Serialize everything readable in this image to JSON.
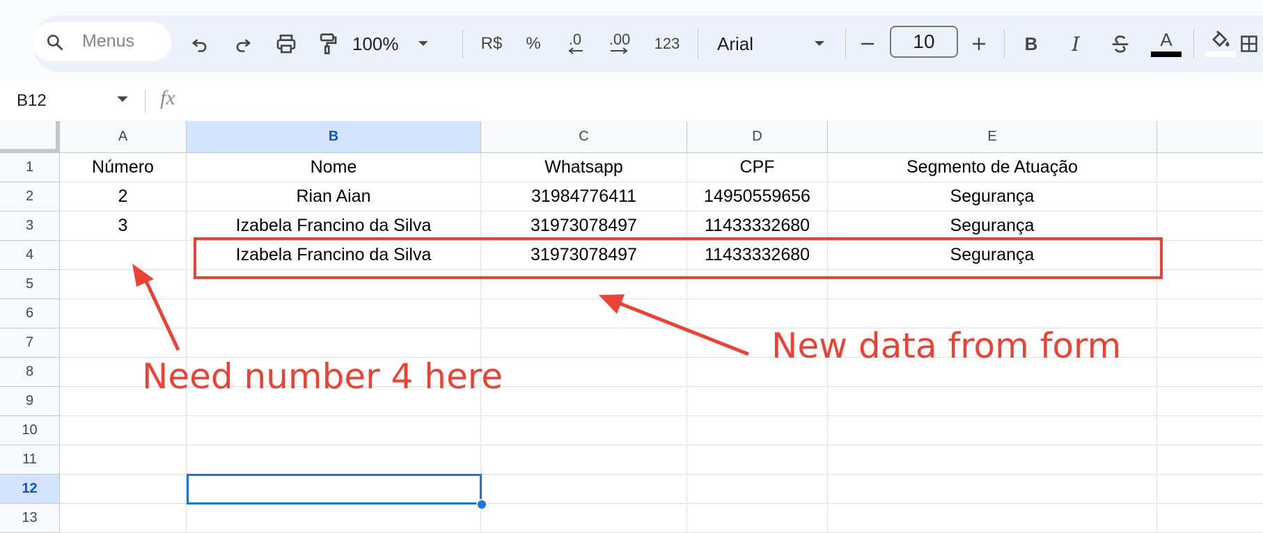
{
  "toolbar": {
    "search_placeholder": "Menus",
    "zoom": "100%",
    "currency": "R$",
    "percent": "%",
    "decrease_decimals": ".0",
    "increase_decimals": ".00",
    "number_format": "123",
    "font": "Arial",
    "font_size": "10",
    "bold": "B",
    "italic": "I",
    "text_color_letter": "A"
  },
  "formula_bar": {
    "cell_ref": "B12",
    "fx": "fx",
    "value": ""
  },
  "columns": [
    "A",
    "B",
    "C",
    "D",
    "E"
  ],
  "rows": [
    {
      "num": "1",
      "cells": [
        "Número",
        "Nome",
        "Whatsapp",
        "CPF",
        "Segmento de Atuação"
      ]
    },
    {
      "num": "2",
      "cells": [
        "2",
        "Rian Aian",
        "31984776411",
        "14950559656",
        "Segurança"
      ]
    },
    {
      "num": "3",
      "cells": [
        "3",
        "Izabela Francino da Silva",
        "31973078497",
        "11433332680",
        "Segurança"
      ]
    },
    {
      "num": "4",
      "cells": [
        "",
        "Izabela Francino da Silva",
        "31973078497",
        "11433332680",
        "Segurança"
      ]
    },
    {
      "num": "5",
      "cells": [
        "",
        "",
        "",
        "",
        ""
      ]
    },
    {
      "num": "6",
      "cells": [
        "",
        "",
        "",
        "",
        ""
      ]
    },
    {
      "num": "7",
      "cells": [
        "",
        "",
        "",
        "",
        ""
      ]
    },
    {
      "num": "8",
      "cells": [
        "",
        "",
        "",
        "",
        ""
      ]
    },
    {
      "num": "9",
      "cells": [
        "",
        "",
        "",
        "",
        ""
      ]
    },
    {
      "num": "10",
      "cells": [
        "",
        "",
        "",
        "",
        ""
      ]
    },
    {
      "num": "11",
      "cells": [
        "",
        "",
        "",
        "",
        ""
      ]
    },
    {
      "num": "12",
      "cells": [
        "",
        "",
        "",
        "",
        ""
      ]
    },
    {
      "num": "13",
      "cells": [
        "",
        "",
        "",
        "",
        ""
      ]
    }
  ],
  "selection": {
    "cell": "B12"
  },
  "annotations": {
    "left_note": "Need number 4 here",
    "right_note": "New data from form",
    "color": "#ea4335"
  }
}
